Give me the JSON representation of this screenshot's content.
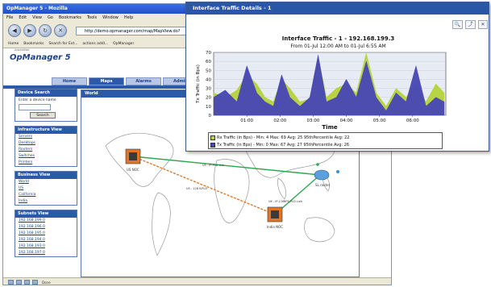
{
  "browser": {
    "title": "OpManager 5 - Mozilla",
    "menu": [
      "File",
      "Edit",
      "View",
      "Go",
      "Bookmarks",
      "Tools",
      "Window",
      "Help"
    ],
    "url": "http://demo.opmanager.com/map/MapView.do?",
    "bookmarks": [
      "Home",
      "Bookmarks",
      "Search for Ext...",
      "actions addl...",
      "OpManager"
    ],
    "status_text": "Done"
  },
  "app": {
    "logo_sub": "AdventNet",
    "logo": "OpManager 5",
    "tabs": [
      "Home",
      "Maps",
      "Alarms",
      "Admin"
    ],
    "active_tab": 1
  },
  "sidebar": {
    "device_search": {
      "title": "Device Search",
      "label": "Enter a device name",
      "button": "Search"
    },
    "infrastructure": {
      "title": "Infrastructure View",
      "items": [
        "Servers",
        "Desktops",
        "Routers",
        "Switches",
        "Printers"
      ]
    },
    "business": {
      "title": "Business View",
      "items": [
        "World",
        "US",
        "California",
        "India"
      ]
    },
    "subnets": {
      "title": "Subnets View",
      "items": [
        "192.168.199.0",
        "192.168.196.0",
        "192.168.195.0",
        "192.168.194.0",
        "192.168.193.0",
        "192.168.197.0"
      ]
    }
  },
  "map": {
    "title": "World",
    "nodes": {
      "us": "US NOC",
      "india": "India NOC",
      "router": "SL.router"
    },
    "links": [
      "US - IP-PLD link",
      "US - 128 K-PLD",
      "UK - IP-2 MBPS-PLD Link"
    ]
  },
  "popup": {
    "title": "Interface Traffic Details - 1",
    "icons": [
      "zoom-in-icon",
      "export-icon",
      "close-icon"
    ],
    "chart_title": "Interface Traffic - 1 - 192.168.199.3",
    "subtitle": "From  01-Jul 12:00 AM to 01-Jul 6:55 AM"
  },
  "chart_data": {
    "type": "area",
    "xlabel": "Time",
    "ylabel": "Tx Traffic (in Bps)",
    "ylim": [
      0,
      70
    ],
    "yticks": [
      0,
      10,
      20,
      30,
      40,
      50,
      60,
      70
    ],
    "xticks": [
      "01:00",
      "02:00",
      "03:00",
      "04:00",
      "05:00",
      "06:00"
    ],
    "xtick_positions": [
      1,
      2,
      3,
      4,
      5,
      6
    ],
    "xlim": [
      0,
      7
    ],
    "series": [
      {
        "name": "Rx Traffic (in Bps) - Min: 4  Max: 69  Avg: 25  95thPercentile Avg: 22",
        "color": "#b5d33a",
        "x": [
          0,
          0.35,
          0.7,
          1.0,
          1.3,
          1.55,
          1.8,
          2.05,
          2.3,
          2.6,
          2.9,
          3.15,
          3.4,
          3.7,
          4.0,
          4.3,
          4.6,
          4.9,
          5.2,
          5.5,
          5.8,
          6.1,
          6.4,
          6.7,
          6.95
        ],
        "values": [
          25,
          20,
          28,
          45,
          35,
          20,
          15,
          40,
          30,
          15,
          18,
          66,
          20,
          30,
          35,
          25,
          69,
          25,
          10,
          30,
          20,
          35,
          15,
          35,
          25
        ]
      },
      {
        "name": "Tx Traffic (in Bps) - Min: 0  Max: 67  Avg: 27  95thPercentile Avg: 26",
        "color": "#4646b4",
        "x": [
          0,
          0.35,
          0.7,
          1.0,
          1.3,
          1.55,
          1.8,
          2.05,
          2.3,
          2.6,
          2.9,
          3.15,
          3.4,
          3.7,
          4.0,
          4.3,
          4.6,
          4.9,
          5.2,
          5.5,
          5.8,
          6.1,
          6.4,
          6.7,
          6.95
        ],
        "values": [
          20,
          28,
          15,
          55,
          25,
          15,
          10,
          45,
          20,
          10,
          20,
          67,
          15,
          20,
          40,
          20,
          60,
          20,
          5,
          25,
          15,
          55,
          10,
          20,
          15
        ]
      }
    ]
  }
}
